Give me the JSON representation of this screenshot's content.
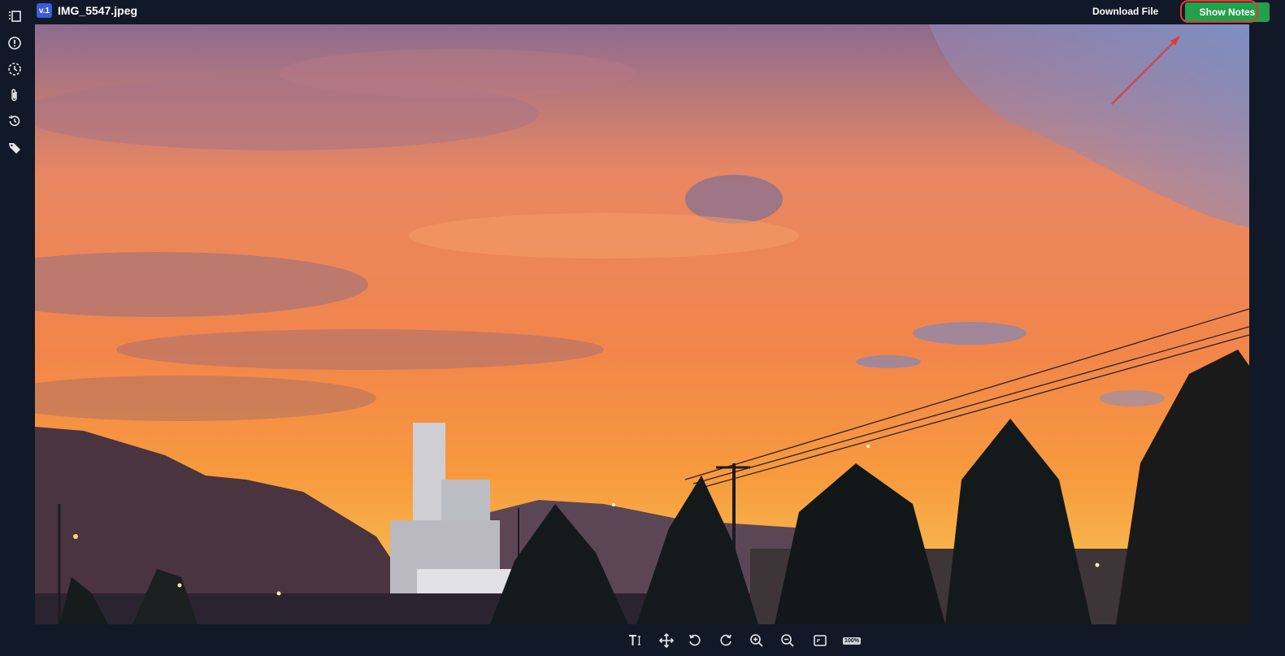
{
  "header": {
    "version_badge": "v.1",
    "file_name": "IMG_5547.jpeg",
    "download_label": "Download File",
    "show_notes_label": "Show Notes"
  },
  "sidebar": {
    "icons": [
      "panel-icon",
      "alert-circle-icon",
      "clock-dashed-icon",
      "paperclip-icon",
      "history-icon",
      "tag-icon"
    ]
  },
  "toolbar": {
    "tools": [
      "text-tool-icon",
      "move-icon",
      "rotate-left-icon",
      "rotate-right-icon",
      "zoom-in-icon",
      "zoom-out-icon",
      "fit-screen-icon"
    ],
    "zoom_label": "100%"
  },
  "colors": {
    "background": "#111827",
    "accent_green": "#22a04b",
    "annotation_red": "#e53935",
    "badge_blue": "#3b5bdb"
  }
}
